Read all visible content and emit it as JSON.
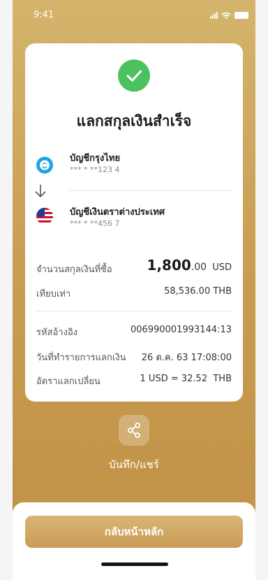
{
  "status_bar": {
    "time": "9:41",
    "signal_icon": "signal-icon",
    "wifi_icon": "wifi-icon",
    "battery_icon": "battery-icon"
  },
  "card": {
    "success_icon": "check-icon",
    "title": "แลกสกุลเงินสำเร็จ",
    "from_account": {
      "name": "บัญชีกรุงไทย",
      "number": "*** * **123 4",
      "icon": "krungthai-logo-icon"
    },
    "arrow_icon": "arrow-down-icon",
    "to_account": {
      "name": "บัญชีเงินตราต่างประเทศ",
      "number": "*** * **456 7",
      "icon": "us-flag-icon"
    },
    "amount": {
      "label": "จำนวนสกุลเงินที่ซื้อ",
      "value_int": "1,800",
      "value_dec": ".00",
      "currency": "USD"
    },
    "equivalent": {
      "label": "เทียบเท่า",
      "value": "58,536.00 THB"
    },
    "reference": {
      "label": "รหัสอ้างอิง",
      "value": "006990001993144:13"
    },
    "date": {
      "label": "วันที่ทำรายการแลกเงิน",
      "value": "26 ต.ค. 63 17:08:00"
    },
    "rate": {
      "label": "อัตราแลกเปลี่ยน",
      "value": "1 USD = 32.52  THB"
    }
  },
  "share": {
    "icon": "share-icon",
    "label": "บันทึก/แชร์"
  },
  "bottom": {
    "home_button": "กลับหน้าหลัก"
  },
  "colors": {
    "gold": "#c99e52",
    "success": "#4cc25f"
  }
}
